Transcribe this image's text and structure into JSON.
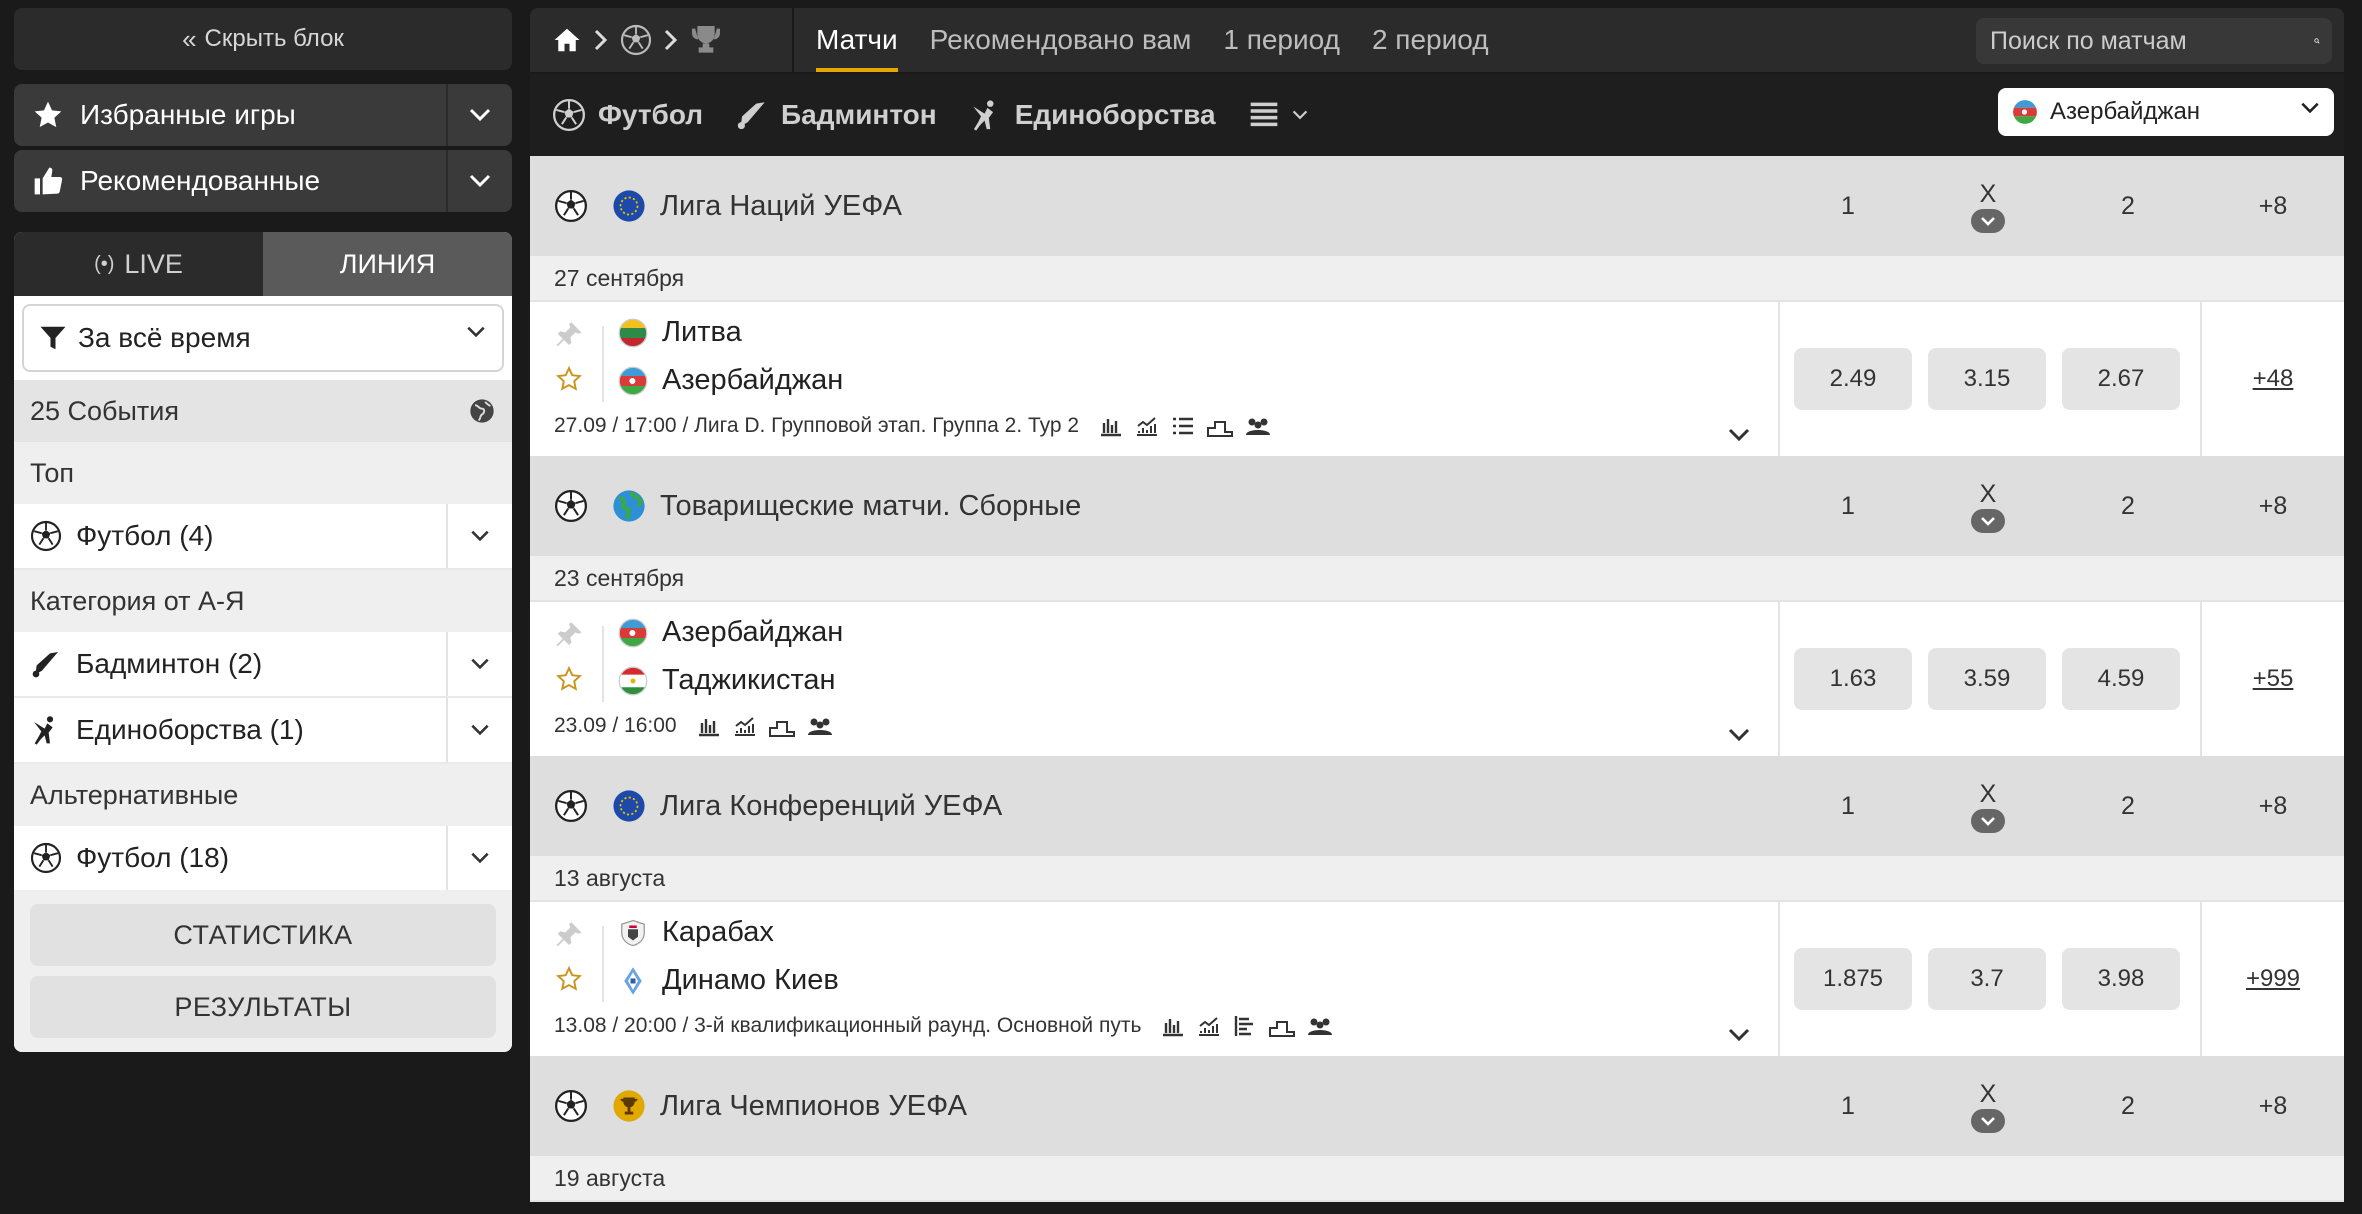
{
  "sidebar": {
    "hide_label": "Скрыть блок",
    "favorites_label": "Избранные игры",
    "recommended_label": "Рекомендованные",
    "tab_live": "LIVE",
    "tab_line": "ЛИНИЯ",
    "filter_label": "За всё время",
    "events_count": "25 События",
    "section_top": "Топ",
    "top_items": [
      {
        "label": "Футбол (4)",
        "icon": "soccer-ball-icon"
      }
    ],
    "section_az": "Категория от А-Я",
    "az_items": [
      {
        "label": "Бадминтон (2)",
        "icon": "shuttlecock-icon"
      },
      {
        "label": "Единоборства (1)",
        "icon": "martial-arts-icon"
      }
    ],
    "section_alt": "Альтернативные",
    "alt_items": [
      {
        "label": "Футбол (18)",
        "icon": "soccer-ball-icon"
      }
    ],
    "stats_button": "СТАТИСТИКА",
    "results_button": "РЕЗУЛЬТАТЫ"
  },
  "topnav": {
    "tabs": [
      "Матчи",
      "Рекомендовано вам",
      "1 период",
      "2 период"
    ],
    "active_tab": "Матчи",
    "search_placeholder": "Поиск по матчам"
  },
  "sports_bar": {
    "items": [
      "Футбол",
      "Бадминтон",
      "Единоборства"
    ],
    "country": "Азербайджан"
  },
  "columns": {
    "c1": "1",
    "cx": "X",
    "c2": "2",
    "more": "+8"
  },
  "leagues": [
    {
      "name": "Лига Наций УЕФА",
      "date": "27 сентября",
      "match": {
        "team1": "Литва",
        "team2": "Азербайджан",
        "meta": "27.09 / 17:00 / Лига D. Групповой этап. Группа 2. Тур 2",
        "odds": [
          "2.49",
          "3.15",
          "2.67"
        ],
        "more": "+48"
      }
    },
    {
      "name": "Товарищеские матчи. Сборные",
      "date": "23 сентября",
      "match": {
        "team1": "Азербайджан",
        "team2": "Таджикистан",
        "meta": "23.09 / 16:00",
        "odds": [
          "1.63",
          "3.59",
          "4.59"
        ],
        "more": "+55"
      }
    },
    {
      "name": "Лига Конференций УЕФА",
      "date": "13 августа",
      "match": {
        "team1": "Карабах",
        "team2": "Динамо Киев",
        "meta": "13.08 / 20:00 / 3-й квалификационный раунд. Основной путь",
        "odds": [
          "1.875",
          "3.7",
          "3.98"
        ],
        "more": "+999"
      }
    },
    {
      "name": "Лига Чемпионов УЕФА",
      "date": "19 августа"
    }
  ],
  "colors": {
    "accent": "#e8a600",
    "dark": "#2b2b2b",
    "odd_bg": "#e4e4e4"
  }
}
